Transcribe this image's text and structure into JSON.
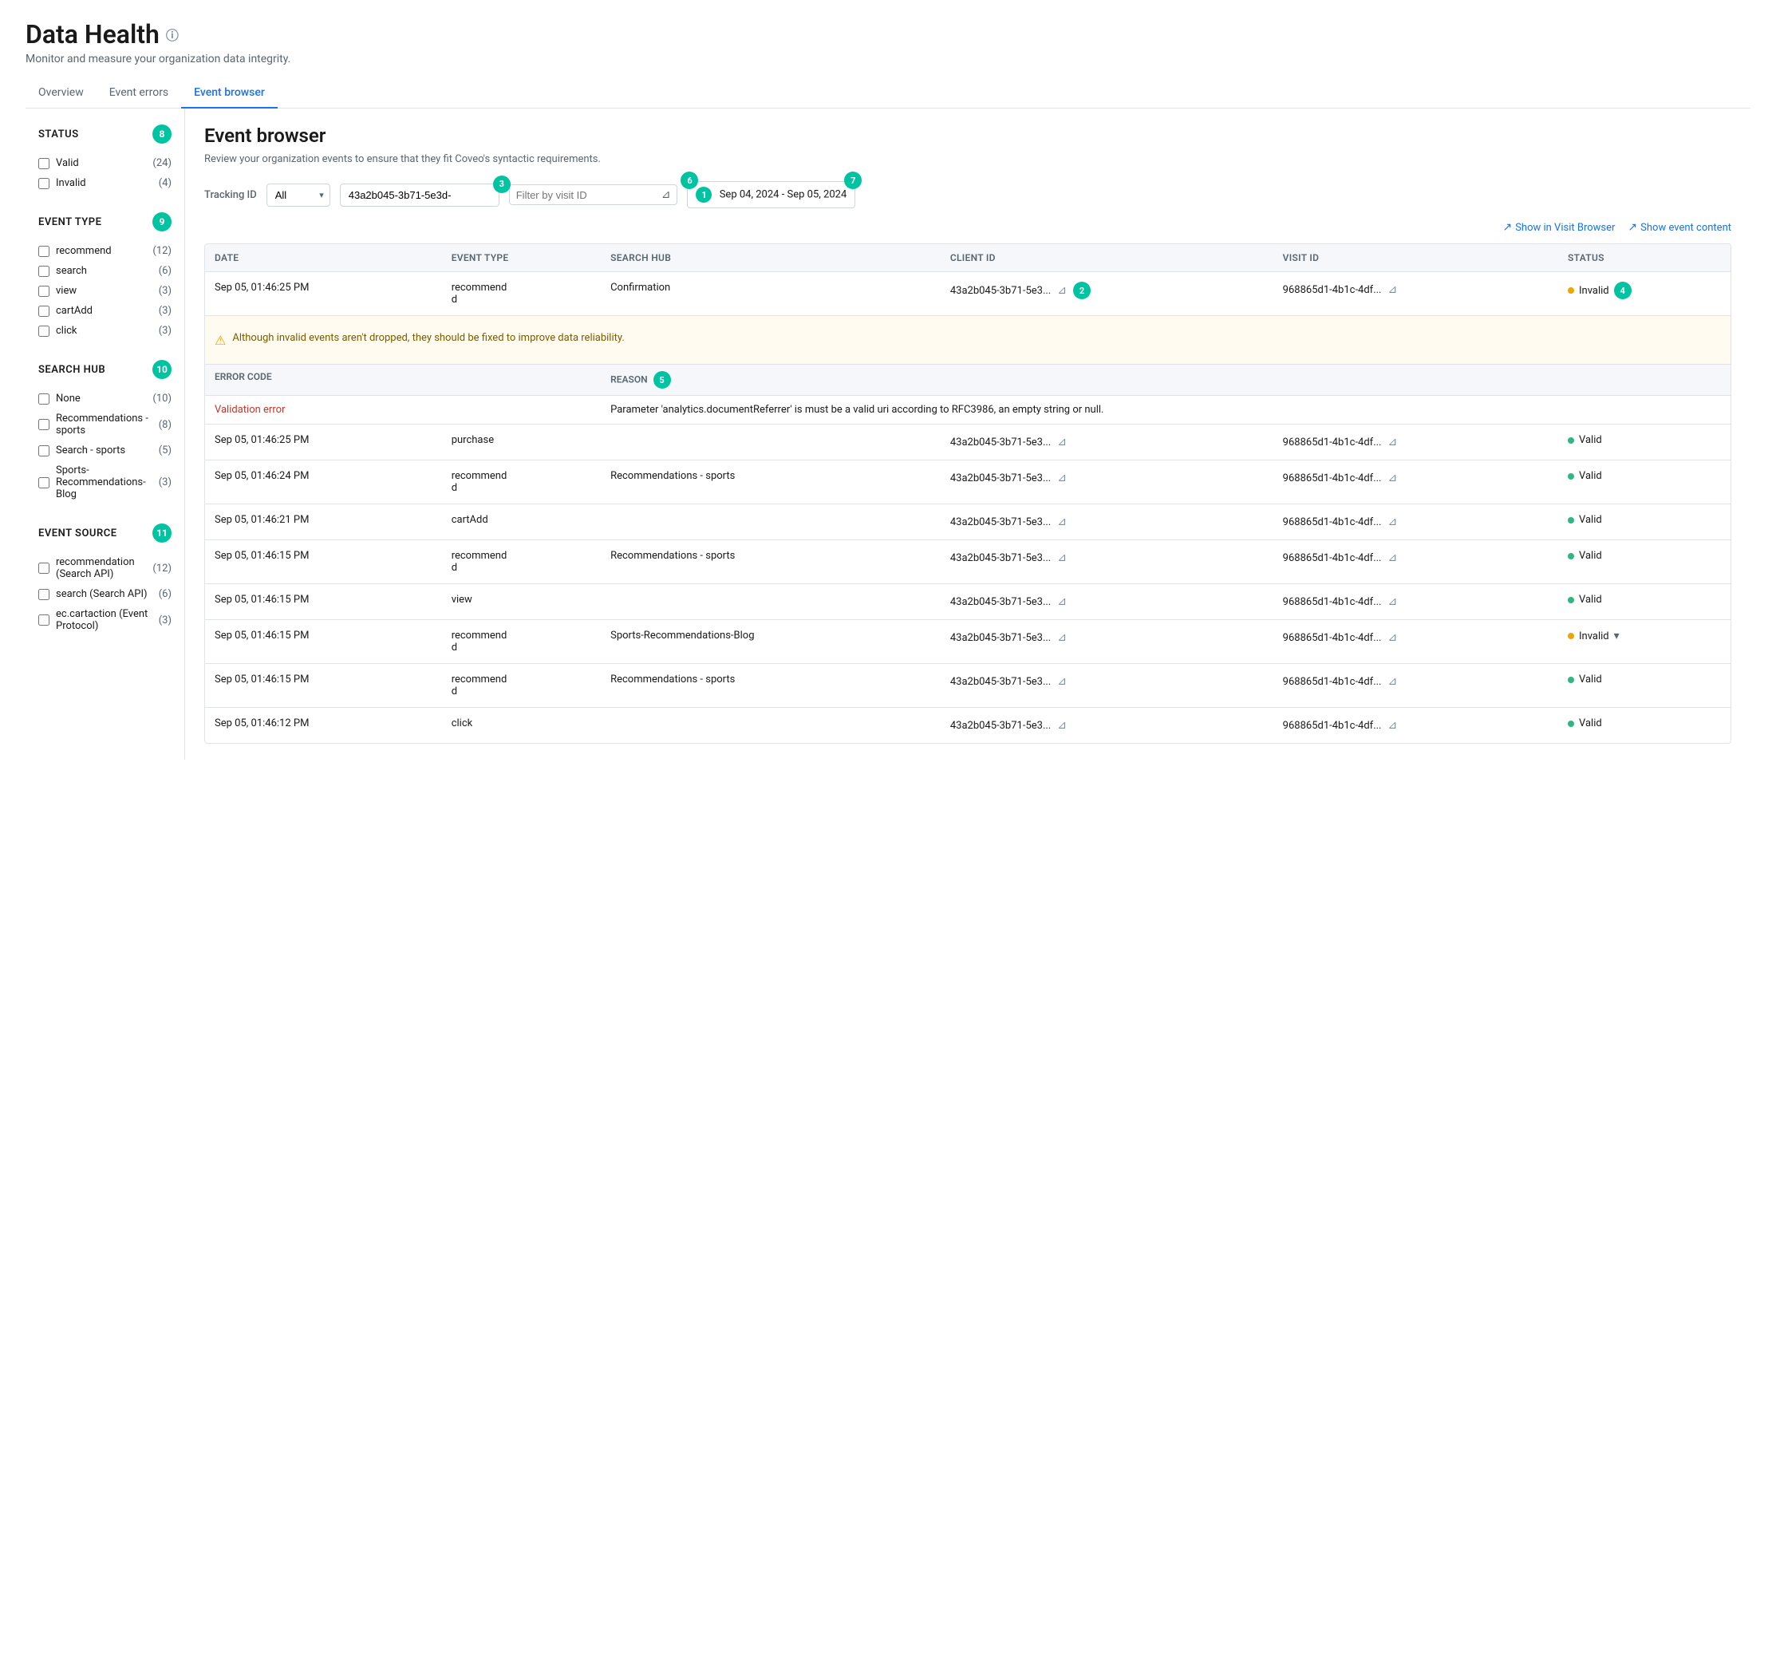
{
  "page": {
    "title": "Data Health",
    "subtitle": "Monitor and measure your organization data integrity.",
    "tabs": [
      {
        "id": "overview",
        "label": "Overview",
        "active": false
      },
      {
        "id": "event-errors",
        "label": "Event errors",
        "active": false
      },
      {
        "id": "event-browser",
        "label": "Event browser",
        "active": true
      }
    ]
  },
  "sidebar": {
    "status": {
      "title": "Status",
      "badge": "8",
      "items": [
        {
          "id": "valid",
          "label": "Valid",
          "count": "(24)",
          "checked": false
        },
        {
          "id": "invalid",
          "label": "Invalid",
          "count": "(4)",
          "checked": false
        }
      ]
    },
    "event_type": {
      "title": "Event type",
      "badge": "9",
      "items": [
        {
          "id": "recommend",
          "label": "recommend",
          "count": "(12)",
          "checked": false
        },
        {
          "id": "search",
          "label": "search",
          "count": "(6)",
          "checked": false
        },
        {
          "id": "view",
          "label": "view",
          "count": "(3)",
          "checked": false
        },
        {
          "id": "cartAdd",
          "label": "cartAdd",
          "count": "(3)",
          "checked": false
        },
        {
          "id": "click",
          "label": "click",
          "count": "(3)",
          "checked": false
        }
      ]
    },
    "search_hub": {
      "title": "Search hub",
      "badge": "10",
      "items": [
        {
          "id": "none",
          "label": "None",
          "count": "(10)",
          "checked": false
        },
        {
          "id": "rec-sports",
          "label": "Recommendations - sports",
          "count": "(8)",
          "checked": false
        },
        {
          "id": "search-sports",
          "label": "Search - sports",
          "count": "(5)",
          "checked": false
        },
        {
          "id": "sports-rec-blog",
          "label": "Sports-Recommendations-Blog",
          "count": "(3)",
          "checked": false
        }
      ]
    },
    "event_source": {
      "title": "Event source",
      "badge": "11",
      "items": [
        {
          "id": "recommendation-search",
          "label": "recommendation (Search API)",
          "count": "(12)",
          "checked": false
        },
        {
          "id": "search-api",
          "label": "search (Search API)",
          "count": "(6)",
          "checked": false
        },
        {
          "id": "ec-cartaction",
          "label": "ec.cartaction (Event Protocol)",
          "count": "(3)",
          "checked": false
        }
      ]
    }
  },
  "event_browser": {
    "title": "Event browser",
    "subtitle": "Review your organization events to ensure that they fit Coveo's syntactic requirements.",
    "filters": {
      "tracking_id_label": "Tracking ID",
      "tracking_id_value": "All",
      "event_id_value": "43a2b045-3b71-5e3d-",
      "event_id_badge": "3",
      "visit_id_placeholder": "Filter by visit ID",
      "date_range": "Sep 04, 2024 - Sep 05, 2024",
      "date_badge_1": "1",
      "date_badge_6": "6",
      "date_badge_7": "7"
    },
    "actions": {
      "show_visit_browser": "Show in Visit Browser",
      "show_event_content": "Show event content"
    },
    "table": {
      "columns": [
        "Date",
        "Event type",
        "Search hub",
        "Client ID",
        "Visit ID",
        "Status"
      ],
      "rows": [
        {
          "date": "Sep 05, 01:46:25 PM",
          "event_type": "recommend d",
          "search_hub": "Confirmation",
          "client_id": "43a2b045-3b71-5e3...",
          "visit_id": "968865d1-4b1c-4df...",
          "status": "Invalid",
          "status_type": "invalid",
          "expanded": true,
          "badge": "2",
          "badge_status": "4",
          "warning_message": "Although invalid events aren't dropped, they should be fixed to improve data reliability.",
          "error_code": "Validation error",
          "error_reason": "Parameter 'analytics.documentReferrer' is must be a valid uri according to RFC3986, an empty string or null."
        },
        {
          "date": "Sep 05, 01:46:25 PM",
          "event_type": "purchase",
          "search_hub": "",
          "client_id": "43a2b045-3b71-5e3...",
          "visit_id": "968865d1-4b1c-4df...",
          "status": "Valid",
          "status_type": "valid",
          "expanded": false
        },
        {
          "date": "Sep 05, 01:46:24 PM",
          "event_type": "recommend d",
          "search_hub": "Recommendations - sports",
          "client_id": "43a2b045-3b71-5e3...",
          "visit_id": "968865d1-4b1c-4df...",
          "status": "Valid",
          "status_type": "valid",
          "expanded": false
        },
        {
          "date": "Sep 05, 01:46:21 PM",
          "event_type": "cartAdd",
          "search_hub": "",
          "client_id": "43a2b045-3b71-5e3...",
          "visit_id": "968865d1-4b1c-4df...",
          "status": "Valid",
          "status_type": "valid",
          "expanded": false
        },
        {
          "date": "Sep 05, 01:46:15 PM",
          "event_type": "recommend d",
          "search_hub": "Recommendations - sports",
          "client_id": "43a2b045-3b71-5e3...",
          "visit_id": "968865d1-4b1c-4df...",
          "status": "Valid",
          "status_type": "valid",
          "expanded": false
        },
        {
          "date": "Sep 05, 01:46:15 PM",
          "event_type": "view",
          "search_hub": "",
          "client_id": "43a2b045-3b71-5e3...",
          "visit_id": "968865d1-4b1c-4df...",
          "status": "Valid",
          "status_type": "valid",
          "expanded": false
        },
        {
          "date": "Sep 05, 01:46:15 PM",
          "event_type": "recommend d",
          "search_hub": "Sports-Recommendations-Blog",
          "client_id": "43a2b045-3b71-5e3...",
          "visit_id": "968865d1-4b1c-4df...",
          "status": "Invalid",
          "status_type": "invalid",
          "expanded": false,
          "has_chevron": true
        },
        {
          "date": "Sep 05, 01:46:15 PM",
          "event_type": "recommend d",
          "search_hub": "Recommendations - sports",
          "client_id": "43a2b045-3b71-5e3...",
          "visit_id": "968865d1-4b1c-4df...",
          "status": "Valid",
          "status_type": "valid",
          "expanded": false
        },
        {
          "date": "Sep 05, 01:46:12 PM",
          "event_type": "click",
          "search_hub": "",
          "client_id": "43a2b045-3b71-5e3...",
          "visit_id": "968865d1-4b1c-4df...",
          "status": "Valid",
          "status_type": "valid",
          "expanded": false
        }
      ]
    }
  }
}
